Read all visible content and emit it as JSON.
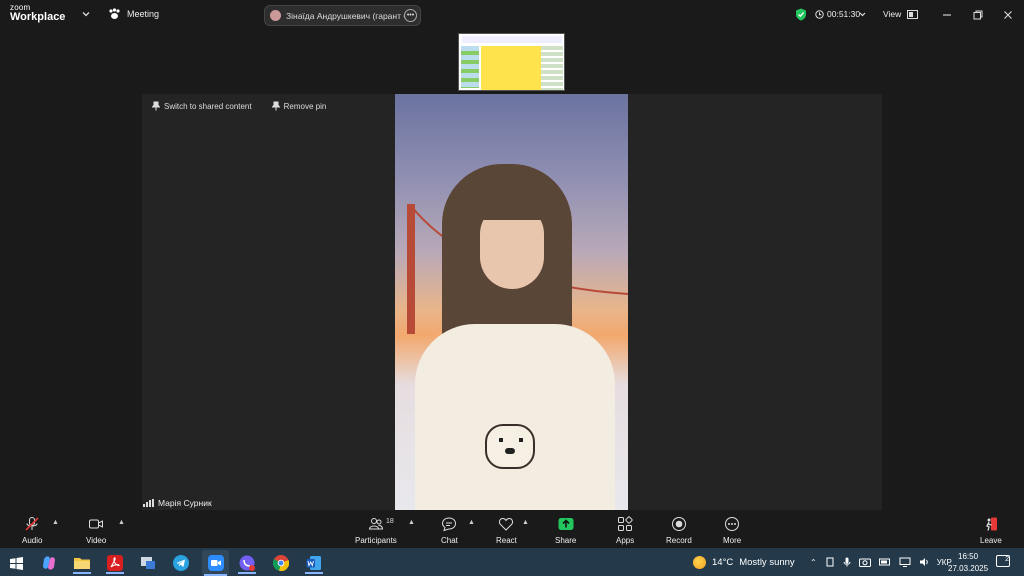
{
  "app": {
    "logo_line1": "zoom",
    "logo_line2": "Workplace",
    "meeting_label": "Meeting"
  },
  "speaker_pill": {
    "name": "Зінаїда Андрушкевич (гарант С"
  },
  "titlebar": {
    "timer": "00:51:30",
    "view_label": "View",
    "shield_color": "#22c55e"
  },
  "pin_bar": {
    "switch_label": "Switch to shared content",
    "remove_label": "Remove pin"
  },
  "participant": {
    "name": "Марія Сурник"
  },
  "toolbar": {
    "audio": "Audio",
    "video": "Video",
    "participants": "Participants",
    "participants_count": "18",
    "chat": "Chat",
    "react": "React",
    "share": "Share",
    "apps": "Apps",
    "record": "Record",
    "more": "More",
    "leave": "Leave",
    "share_color": "#22c55e",
    "leave_color": "#e53935"
  },
  "taskbar": {
    "weather_temp": "14°C",
    "weather_desc": "Mostly sunny",
    "lang": "УКР",
    "time": "16:50",
    "date": "27.03.2025",
    "notif_count": "2",
    "apps": [
      "windows-start",
      "copilot",
      "file-explorer",
      "acrobat",
      "network-app",
      "telegram",
      "zoom",
      "viber",
      "chrome",
      "word"
    ]
  }
}
